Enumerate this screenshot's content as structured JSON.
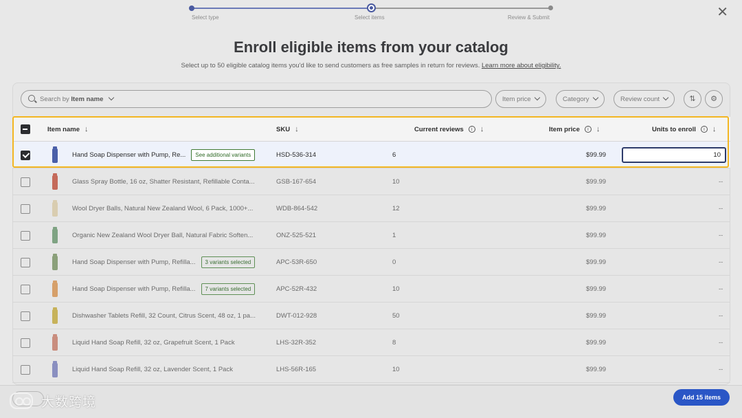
{
  "stepper": {
    "steps": [
      "Select type",
      "Select items",
      "Review & Submit"
    ]
  },
  "header": {
    "title": "Enroll eligible items from your catalog",
    "subtitle": "Select up to 50 eligible catalog items you'd like to send customers as free samples in return for reviews.",
    "link": "Learn more about eligibility."
  },
  "toolbar": {
    "search_prefix": "Search by",
    "search_field": "Item name",
    "filters": [
      "Item price",
      "Category",
      "Review count"
    ]
  },
  "table": {
    "columns": [
      "Item name",
      "SKU",
      "Current reviews",
      "Item price",
      "Units to enroll"
    ],
    "rows": [
      {
        "name": "Hand Soap Dispenser with Pump, Re...",
        "variant": "See additional variants",
        "sku": "HSD-536-314",
        "reviews": "6",
        "price": "$99.99",
        "units": "10",
        "checked": true,
        "thumb": "#4a5fa8"
      },
      {
        "name": "Glass Spray Bottle, 16 oz, Shatter Resistant, Refillable Conta...",
        "variant": "",
        "sku": "GSB-167-654",
        "reviews": "10",
        "price": "$99.99",
        "units": "--",
        "checked": false,
        "thumb": "#c56a5a"
      },
      {
        "name": "Wool Dryer Balls, Natural New Zealand Wool, 6 Pack, 1000+...",
        "variant": "",
        "sku": "WDB-864-542",
        "reviews": "12",
        "price": "$99.99",
        "units": "--",
        "checked": false,
        "thumb": "#d9cdb0"
      },
      {
        "name": "Organic New Zealand Wool Dryer Ball, Natural Fabric Soften...",
        "variant": "",
        "sku": "ONZ-525-521",
        "reviews": "1",
        "price": "$99.99",
        "units": "--",
        "checked": false,
        "thumb": "#7fa383"
      },
      {
        "name": "Hand Soap Dispenser with Pump, Refilla...",
        "variant": "3 variants selected",
        "sku": "APC-53R-650",
        "reviews": "0",
        "price": "$99.99",
        "units": "--",
        "checked": false,
        "thumb": "#8ba07a"
      },
      {
        "name": "Hand Soap Dispenser with Pump, Refilla...",
        "variant": "7 variants selected",
        "sku": "APC-52R-432",
        "reviews": "10",
        "price": "$99.99",
        "units": "--",
        "checked": false,
        "thumb": "#d6a06a"
      },
      {
        "name": "Dishwasher Tablets Refill, 32 Count, Citrus Scent, 48 oz, 1 pa...",
        "variant": "",
        "sku": "DWT-012-928",
        "reviews": "50",
        "price": "$99.99",
        "units": "--",
        "checked": false,
        "thumb": "#c7b25a"
      },
      {
        "name": "Liquid Hand Soap Refill, 32 oz, Grapefruit Scent, 1 Pack",
        "variant": "",
        "sku": "LHS-32R-352",
        "reviews": "8",
        "price": "$99.99",
        "units": "--",
        "checked": false,
        "thumb": "#c98d7e"
      },
      {
        "name": "Liquid Hand Soap Refill, 32 oz, Lavender Scent, 1 Pack",
        "variant": "",
        "sku": "LHS-56R-165",
        "reviews": "10",
        "price": "$99.99",
        "units": "--",
        "checked": false,
        "thumb": "#8a8fc0"
      }
    ]
  },
  "footer": {
    "add_button": "Add 15 items",
    "watermark": "大数跨境"
  },
  "colors": {
    "accent": "#2a56c6",
    "highlight": "#f3b622",
    "variant_green": "#3a6e33"
  }
}
